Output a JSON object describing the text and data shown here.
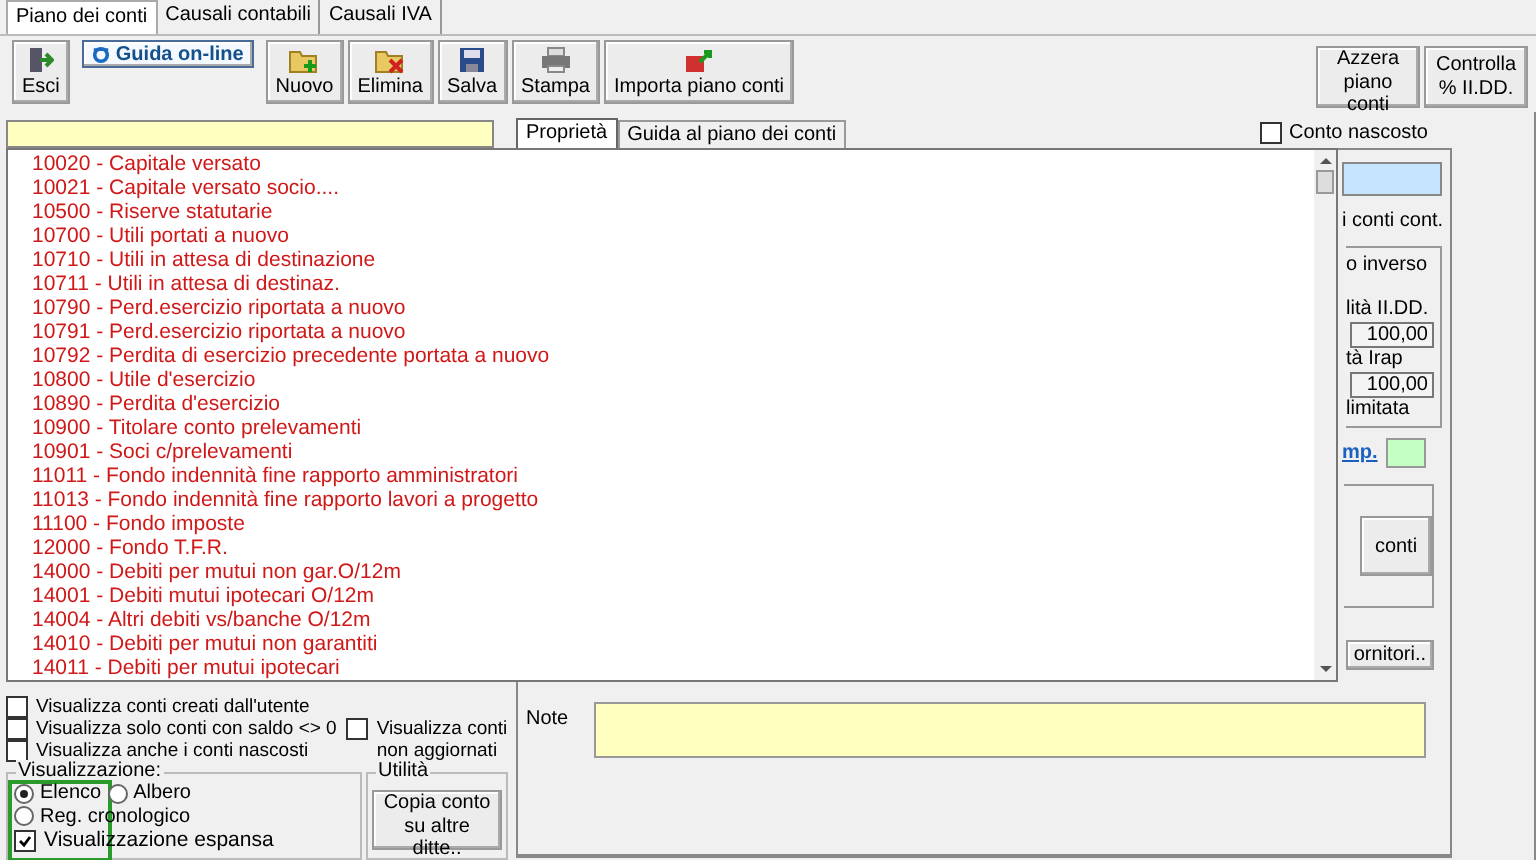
{
  "tabs": [
    {
      "label": "Piano dei conti",
      "selected": true
    },
    {
      "label": "Causali contabili",
      "selected": false
    },
    {
      "label": "Causali IVA",
      "selected": false
    }
  ],
  "toolbar": {
    "exit": "Esci",
    "help": "Guida on-line",
    "buttons": [
      {
        "kind": "new",
        "label": "Nuovo"
      },
      {
        "kind": "delete",
        "label": "Elimina"
      },
      {
        "kind": "save",
        "label": "Salva"
      },
      {
        "kind": "print",
        "label": "Stampa"
      },
      {
        "kind": "import",
        "label": "Importa piano conti"
      }
    ],
    "right_buttons": [
      "Azzera piano conti",
      "Controlla % II.DD."
    ]
  },
  "panel_tabs": [
    {
      "label": "Proprietà",
      "selected": true
    },
    {
      "label": "Guida al piano dei conti",
      "selected": false
    }
  ],
  "hidden_account": {
    "label": "Conto nascosto",
    "checked": false
  },
  "accounts": [
    "10020 - Capitale versato",
    "10021 - Capitale versato socio....",
    "10500 - Riserve statutarie",
    "10700 - Utili portati a nuovo",
    "10710 - Utili in attesa di destinazione",
    "10711 - Utili in attesa di destinaz.",
    "10790 - Perd.esercizio riportata a nuovo",
    "10791 - Perd.esercizio riportata a nuovo",
    "10792 - Perdita di esercizio precedente portata a nuovo",
    "10800 - Utile d'esercizio",
    "10890 - Perdita d'esercizio",
    "10900 - Titolare conto prelevamenti",
    "10901 - Soci c/prelevamenti",
    "11011 - Fondo indennità fine rapporto amministratori",
    "11013 - Fondo indennità fine rapporto lavori a progetto",
    "11100 - Fondo imposte",
    "12000 - Fondo T.F.R.",
    "14000 - Debiti per mutui non gar.O/12m",
    "14001 - Debiti mutui ipotecari O/12m",
    "14004 - Altri debiti vs/banche O/12m",
    "14010 - Debiti per mutui non garantiti",
    "14011 - Debiti per mutui ipotecari"
  ],
  "properties": {
    "line_1": "i conti cont.",
    "group_title": "o inverso",
    "label_1": "lità II.DD.",
    "value_1": "100,00",
    "label_2": "tà Irap",
    "value_2": "100,00",
    "label_3": "limitata",
    "link": "mp.",
    "button_1": "conti",
    "button_2": "ornitori.."
  },
  "note": {
    "label": "Note"
  },
  "filters": [
    {
      "label": "Visualizza conti creati dall'utente",
      "checked": false
    },
    {
      "label": "Visualizza solo conti con saldo <> 0",
      "checked": false
    },
    {
      "label": "Visualizza anche i conti nascosti",
      "checked": false
    }
  ],
  "not_updated": {
    "label": "Visualizza conti non aggiornati",
    "checked": false
  },
  "view": {
    "title": "Visualizzazione:",
    "options": [
      {
        "label": "Elenco",
        "selected": true
      },
      {
        "label": "Albero",
        "selected": false
      },
      {
        "label": "Reg. cronologico",
        "selected": false
      }
    ],
    "expanded": {
      "label": "Visualizzazione espansa",
      "checked": true
    }
  },
  "utility": {
    "title": "Utilità",
    "button": "Copia conto su altre ditte.."
  }
}
